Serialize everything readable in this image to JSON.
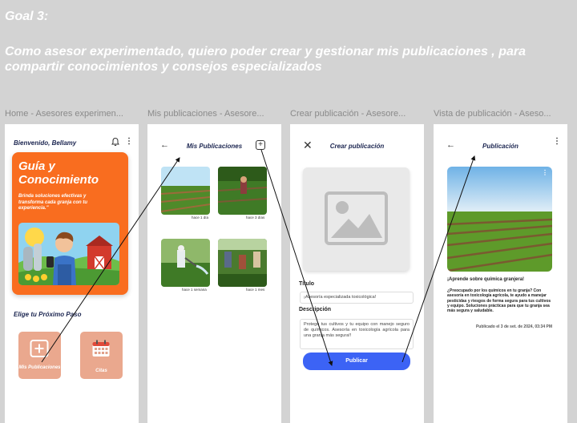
{
  "goal": {
    "title": "Goal 3:",
    "description": "Como asesor experimentado, quiero poder crear y gestionar mis publicaciones , para compartir conocimientos y consejos especializados"
  },
  "frames": [
    "Home - Asesores experimen...",
    "Mis publicaciones - Asesore...",
    "Crear publicación - Asesore...",
    "Vista de publicación - Aseso..."
  ],
  "home": {
    "greeting": "Bienvenido, Bellamy",
    "menu_glyph": "⋮",
    "hero_title_1": "Guía y",
    "hero_title_2": "Conocimiento",
    "hero_text": "Brinda soluciones efectivas y transforma cada granja con tu experiencia.\"",
    "section_title": "Elige tu Próximo Paso",
    "tiles": [
      {
        "label": "Mis Publicaciones",
        "icon": "plus-square-icon"
      },
      {
        "label": "Citas",
        "icon": "calendar-icon"
      }
    ],
    "accent": "#f96d1f",
    "tile_color": "#eaa88e"
  },
  "mis_publicaciones": {
    "back_glyph": "←",
    "title": "Mis Publicaciones",
    "add_glyph": "+",
    "posts": [
      {
        "time": "hace 1 día"
      },
      {
        "time": "hace 3 días"
      },
      {
        "time": "hace 1 semana"
      },
      {
        "time": "hace 1 mes"
      }
    ]
  },
  "crear": {
    "close_glyph": "✕",
    "title": "Crear publicación",
    "titulo_label": "Título",
    "titulo_value": "¡Asesoría especializada toxicológica!",
    "descripcion_label": "Descripción",
    "descripcion_value": "Protege tus cultivos y tu equipo con manejo seguro de químicos. Asesoría en toxicología agrícola para una granja más segura!!",
    "publish_label": "Publicar",
    "button_color": "#3c63f5"
  },
  "vista": {
    "back_glyph": "←",
    "title": "Publicación",
    "menu_glyph": "⋮",
    "image_menu_glyph": "⋮",
    "post_title": "¡Aprende sobre química granjera!",
    "post_body": "¿Preocupado por los químicos en tu granja? Con asesoría en toxicología agrícola, te ayudo a manejar pesticidas y riesgos de forma segura para tus cultivos y equipo. Soluciones prácticas para que tu granja sea más segura y saludable.",
    "post_date": "Publicado el 3 de set. de 2024, 03:34 PM"
  }
}
